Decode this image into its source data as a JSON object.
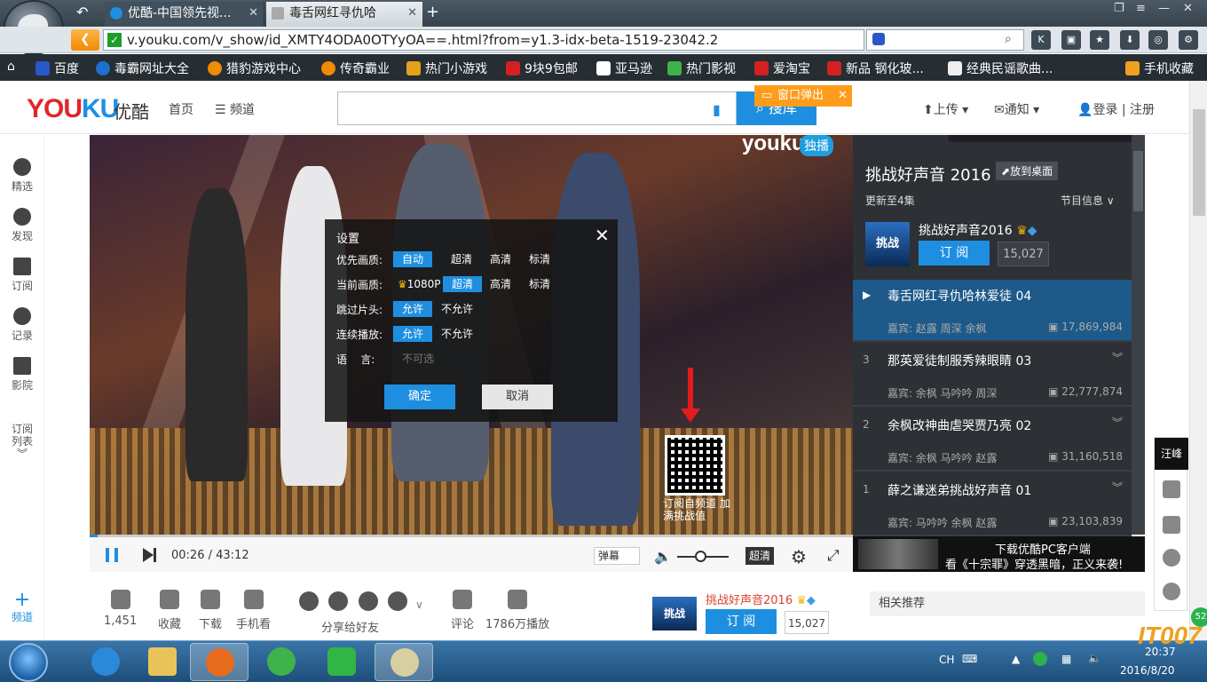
{
  "browser": {
    "tabs": [
      {
        "label": "优酷-中国领先视..."
      },
      {
        "label": "毒舌网红寻仇哈"
      }
    ],
    "new_tab": "+",
    "url": "v.youku.com/v_show/id_XMTY4ODA0OTYyOA==.html?from=y1.3-idx-beta-1519-23042.2",
    "bookmarks": [
      "百度",
      "毒霸网址大全",
      "猎豹游戏中心",
      "传奇霸业",
      "热门小游戏",
      "9块9包邮",
      "亚马逊",
      "热门影视",
      "爱淘宝",
      "新品 钢化玻...",
      "经典民谣歌曲...",
      "手机收藏"
    ]
  },
  "header": {
    "logo_you": "YOU",
    "logo_ku": "KU",
    "logo_cn": "优酷",
    "nav_home": "首页",
    "nav_channel": "频道",
    "search_button": "搜库",
    "popup_label": "窗口弹出",
    "upload": "上传",
    "notify": "通知",
    "login": "登录 | 注册"
  },
  "left_sidebar": [
    "精选",
    "发现",
    "订阅",
    "记录",
    "影院",
    "订阅列表",
    "频道"
  ],
  "player": {
    "watermark": "youku",
    "watermark_badge": "独播",
    "qr_caption": "订阅自频道 加满挑战值",
    "current_time": "00:26",
    "total_time": "43:12",
    "progress_fraction": 0.01,
    "volume_fraction": 0.45,
    "danmu": "弹幕",
    "quality": "超清"
  },
  "settings_dialog": {
    "title": "设置",
    "rows": [
      {
        "label": "优先画质:",
        "options": [
          "自动",
          "超清",
          "高清",
          "标清"
        ],
        "selected": 0
      },
      {
        "label": "当前画质:",
        "options": [
          "1080P",
          "超清",
          "高清",
          "标清"
        ],
        "selected": 1
      },
      {
        "label": "跳过片头:",
        "options": [
          "允许",
          "不允许"
        ],
        "selected": 0
      },
      {
        "label": "连续播放:",
        "options": [
          "允许",
          "不允许"
        ],
        "selected": 0
      },
      {
        "label": "语    言:",
        "options": [
          "不可选"
        ],
        "selected": -1
      }
    ],
    "ok": "确定",
    "cancel": "取消"
  },
  "right_panel": {
    "show_title": "挑战好声音 2016",
    "pin": "放到桌面",
    "updated": "更新至4集",
    "program_info": "节目信息",
    "sub_name": "挑战好声音2016",
    "sub_button": "订 阅",
    "sub_count": "15,027",
    "thumb_text": "挑战",
    "episodes": [
      {
        "no": "",
        "title": "毒舌网红寻仇哈林爱徒 04",
        "guests": "嘉宾: 赵露  周深  余枫",
        "views": "17,869,984",
        "current": true
      },
      {
        "no": "3",
        "title": "那英爱徒制服秀辣眼睛 03",
        "guests": "嘉宾: 余枫  马吟吟  周深",
        "views": "22,777,874",
        "current": false
      },
      {
        "no": "2",
        "title": "余枫改神曲虐哭贾乃亮 02",
        "guests": "嘉宾: 余枫  马吟吟  赵露",
        "views": "31,160,518",
        "current": false
      },
      {
        "no": "1",
        "title": "薛之谦迷弟挑战好声音 01",
        "guests": "嘉宾: 马吟吟  余枫  赵露",
        "views": "23,103,839",
        "current": false
      }
    ],
    "ad_line1": "下载优酷PC客户端",
    "ad_line2": "看《十宗罪》穿透黑暗，正义来袭!"
  },
  "actions": {
    "like_count": "1,451",
    "favorite": "收藏",
    "download": "下载",
    "mobile": "手机看",
    "share": "分享给好友",
    "comment": "评论",
    "plays": "1786万播放"
  },
  "bottom_sub": {
    "name": "挑战好声音2016",
    "button": "订 阅",
    "count": "15,027"
  },
  "related": "相关推荐",
  "float_bar_top": "汪峰",
  "taskbar": {
    "lang": "CH",
    "time": "20:37",
    "date": "2016/8/20"
  },
  "watermark": "IT007",
  "badge": "52"
}
